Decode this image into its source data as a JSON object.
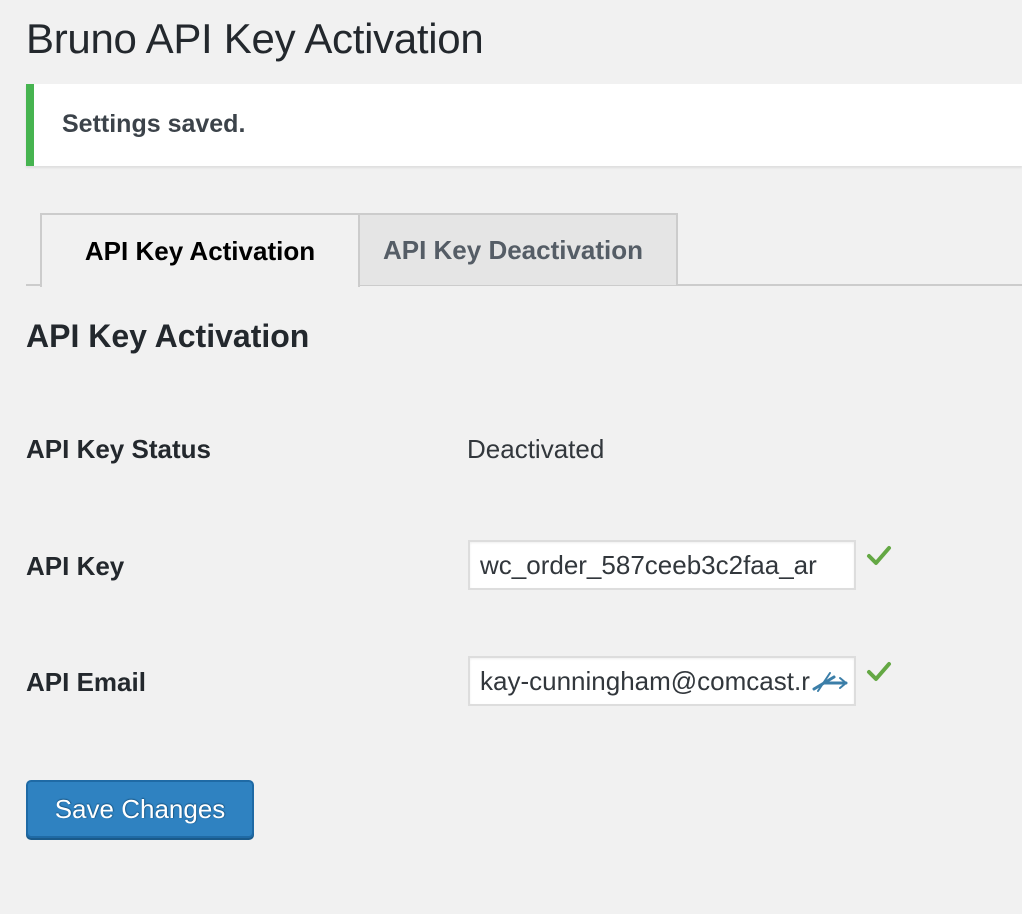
{
  "page": {
    "title": "Bruno API Key Activation"
  },
  "notice": {
    "text": "Settings saved.",
    "color": "#46b450"
  },
  "tabs": [
    {
      "label": "API Key Activation",
      "active": true
    },
    {
      "label": "API Key Deactivation",
      "active": false
    }
  ],
  "section": {
    "title": "API Key Activation"
  },
  "fields": {
    "status": {
      "label": "API Key Status",
      "value": "Deactivated"
    },
    "api_key": {
      "label": "API Key",
      "value": "wc_order_587ceeb3c2faa_ar",
      "valid_icon": "checkmark-icon"
    },
    "api_email": {
      "label": "API Email",
      "value": "kay-cunningham@comcast.r",
      "valid_icon": "checkmark-icon",
      "autofill_icon": "password-manager-icon"
    }
  },
  "actions": {
    "save_label": "Save Changes",
    "color": "#2f82c1"
  }
}
